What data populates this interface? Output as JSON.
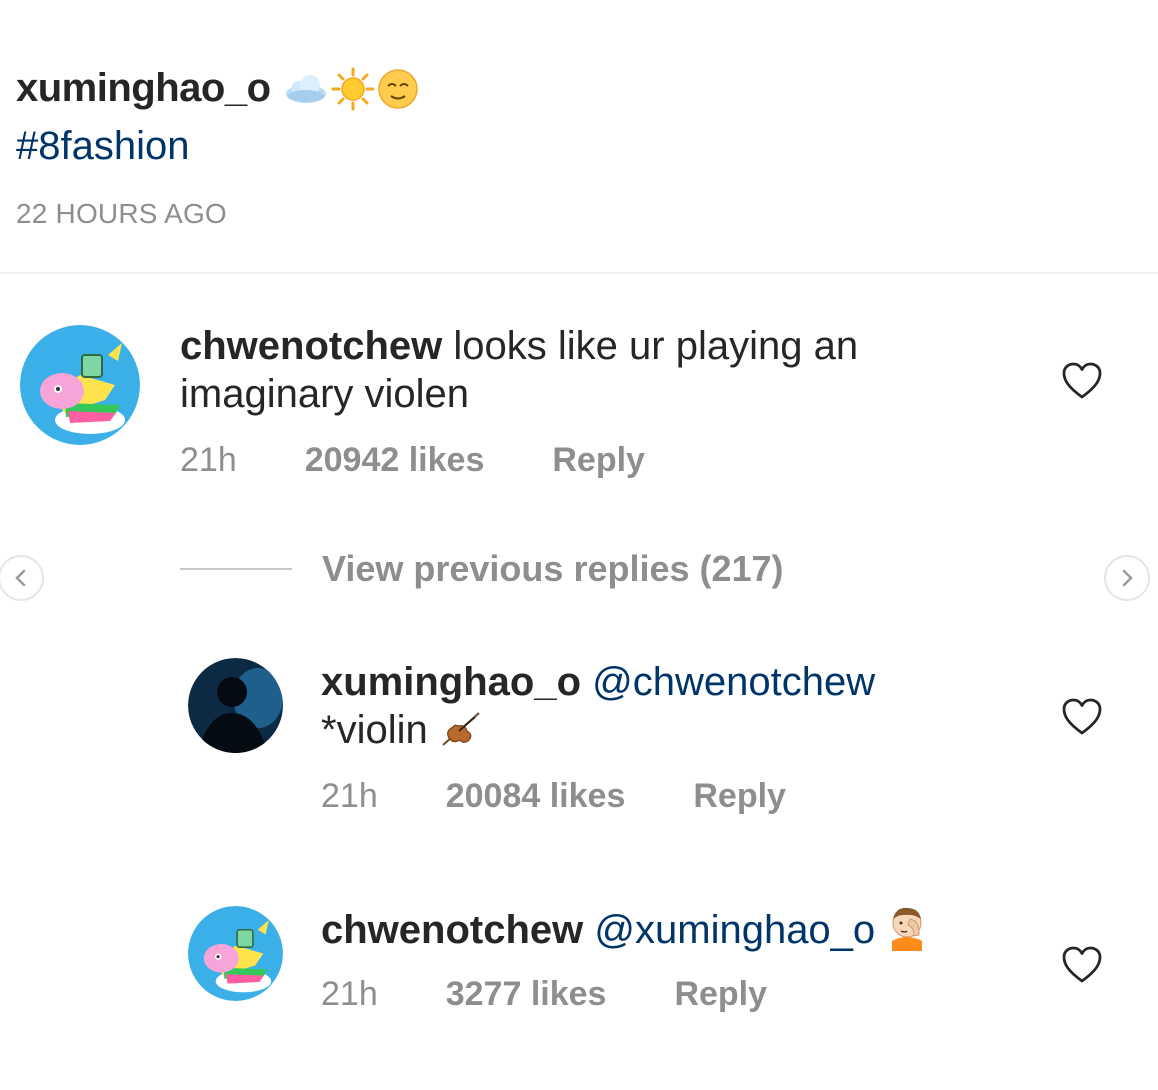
{
  "caption": {
    "username": "xuminghao_o",
    "emoji_icons": [
      "cloud-emoji-icon",
      "sun-emoji-icon",
      "relieved-face-emoji-icon"
    ],
    "hashtag": "#8fashion",
    "timestamp": "22 HOURS AGO"
  },
  "comments": [
    {
      "username": "chwenotchew",
      "text": "looks like ur playing an imaginary violen",
      "time": "21h",
      "likes": "20942 likes",
      "reply_label": "Reply"
    }
  ],
  "view_replies": {
    "label": "View previous replies (217)"
  },
  "replies": [
    {
      "username": "xuminghao_o",
      "mention": "@chwenotchew",
      "text": "*violin",
      "emoji_icon": "violin-emoji-icon",
      "time": "21h",
      "likes": "20084 likes",
      "reply_label": "Reply"
    },
    {
      "username": "chwenotchew",
      "mention": "@xuminghao_o",
      "text": "",
      "emoji_icon": "facepalm-emoji-icon",
      "time": "21h",
      "likes": "3277 likes",
      "reply_label": "Reply"
    }
  ],
  "colors": {
    "text": "#262626",
    "muted": "#8e8e8e",
    "link": "#003569",
    "divider": "#efefef"
  }
}
